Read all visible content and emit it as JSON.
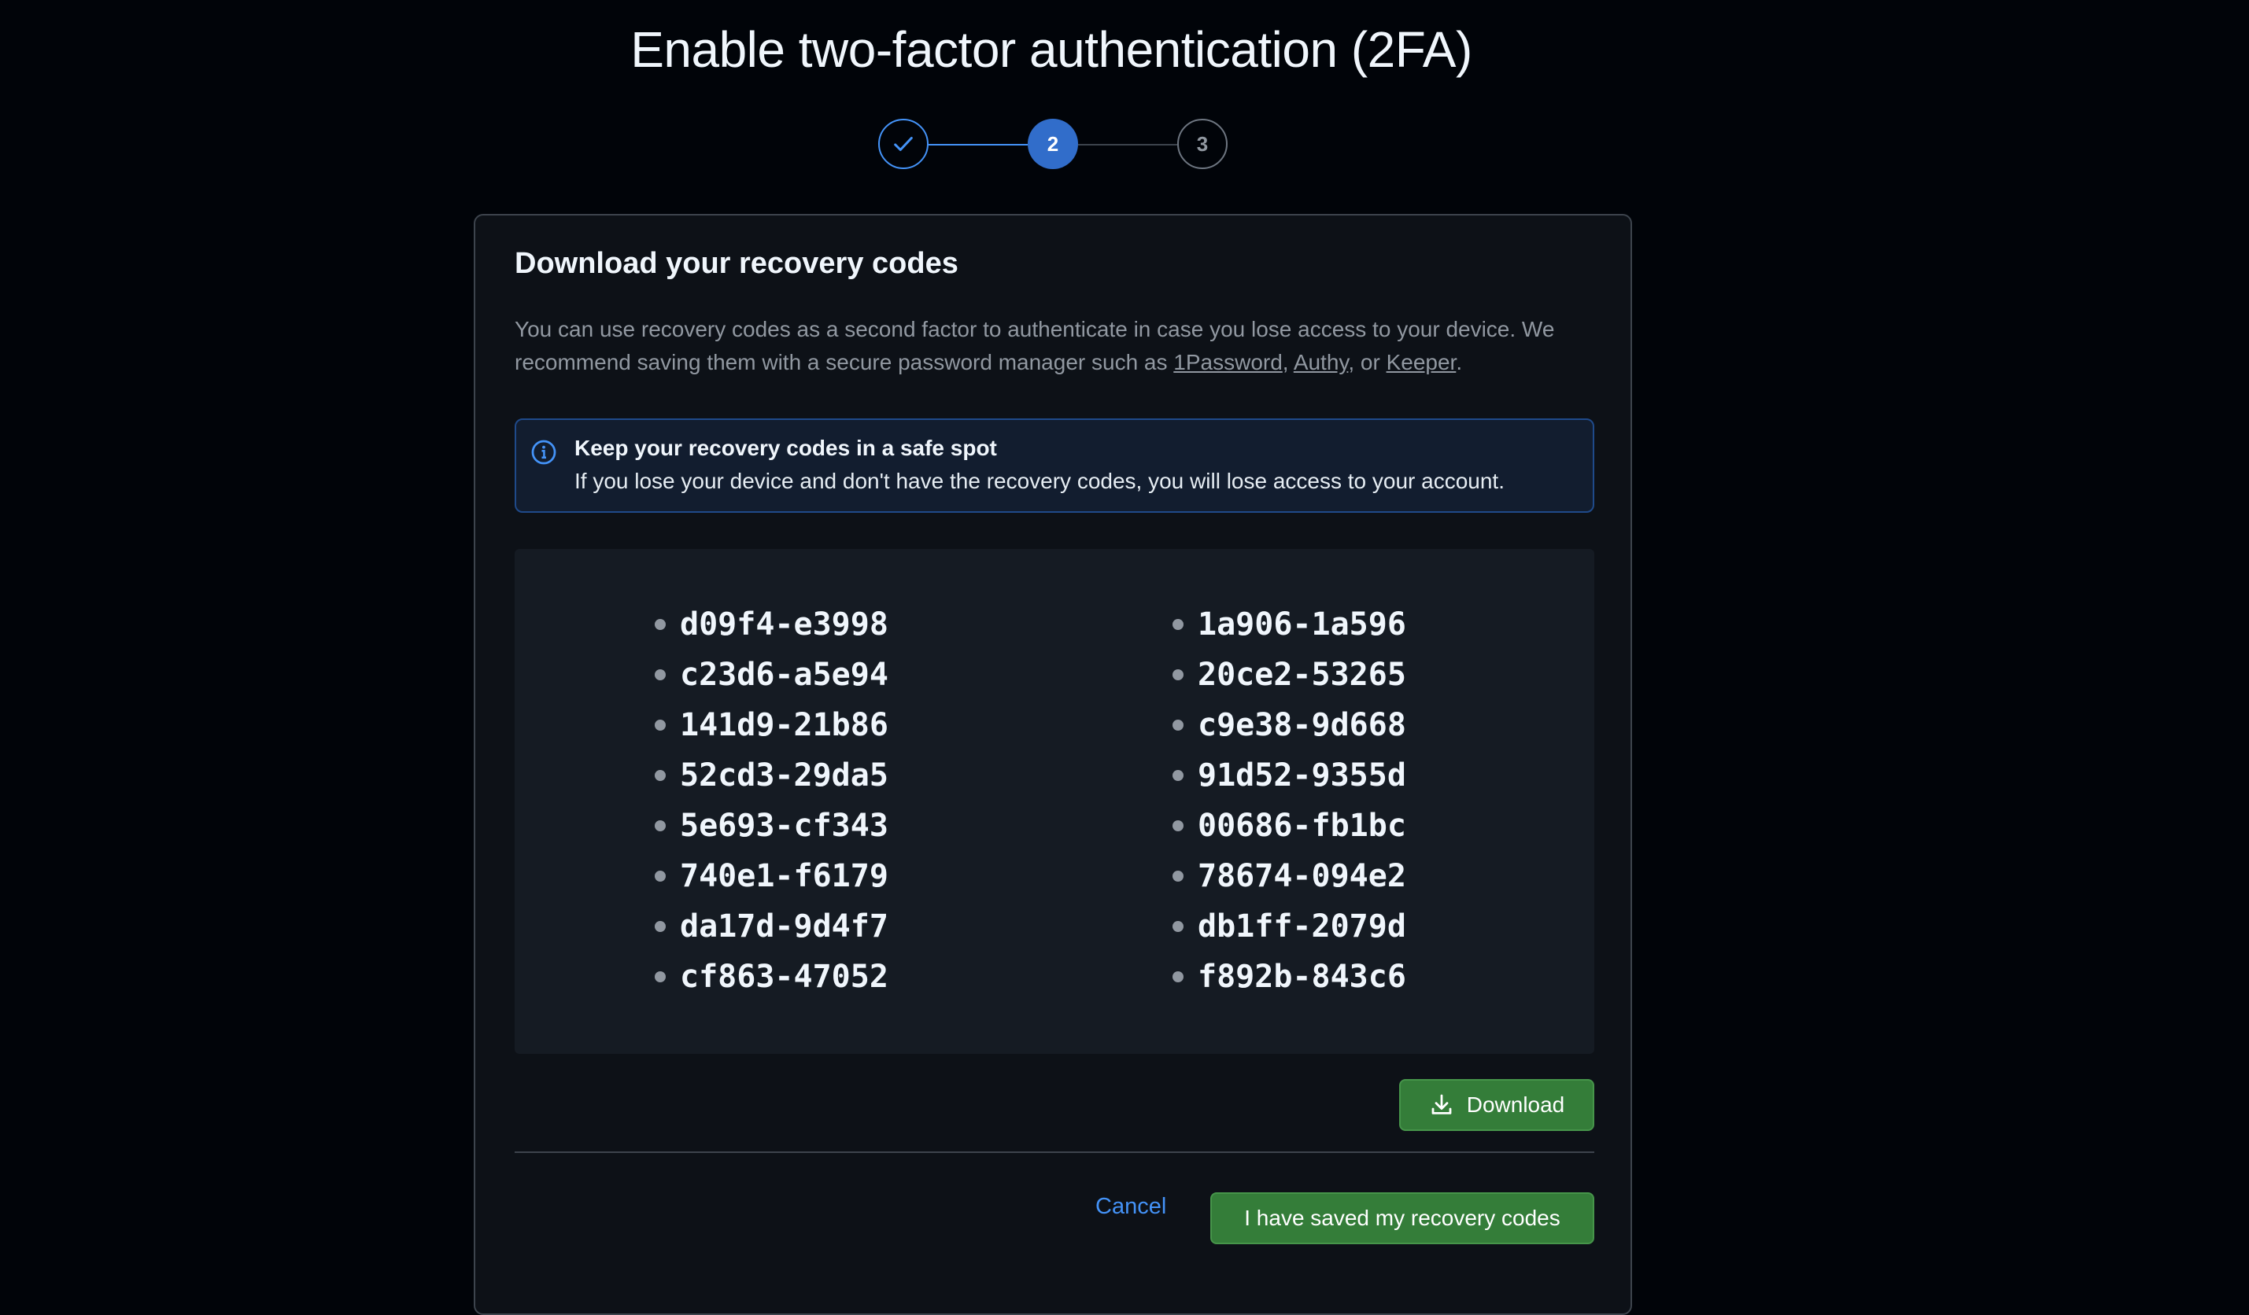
{
  "page": {
    "title": "Enable two-factor authentication (2FA)"
  },
  "stepper": {
    "steps": [
      {
        "label": "",
        "state": "complete",
        "icon": "check-icon"
      },
      {
        "label": "2",
        "state": "current"
      },
      {
        "label": "3",
        "state": "upcoming"
      }
    ]
  },
  "card": {
    "title": "Download your recovery codes",
    "description": {
      "text_before": "You can use recovery codes as a second factor to authenticate in case you lose access to your device. We recommend saving them with a secure password manager such as ",
      "link1": "1Password",
      "sep1": ", ",
      "link2": "Authy",
      "sep2": ", or ",
      "link3": "Keeper",
      "text_after": "."
    },
    "flash": {
      "icon": "info-icon",
      "title": "Keep your recovery codes in a safe spot",
      "text": "If you lose your device and don't have the recovery codes, you will lose access to your account."
    },
    "codes": {
      "column1": [
        "d09f4-e3998",
        "c23d6-a5e94",
        "141d9-21b86",
        "52cd3-29da5",
        "5e693-cf343",
        "740e1-f6179",
        "da17d-9d4f7",
        "cf863-47052"
      ],
      "column2": [
        "1a906-1a596",
        "20ce2-53265",
        "c9e38-9d668",
        "91d52-9355d",
        "00686-fb1bc",
        "78674-094e2",
        "db1ff-2079d",
        "f892b-843c6"
      ]
    },
    "download_button": "Download",
    "cancel_button": "Cancel",
    "confirm_button": "I have saved my recovery codes"
  },
  "colors": {
    "background": "#010409",
    "card": "#0d1117",
    "accent_blue": "#4493f8",
    "button_green": "#347d39"
  }
}
